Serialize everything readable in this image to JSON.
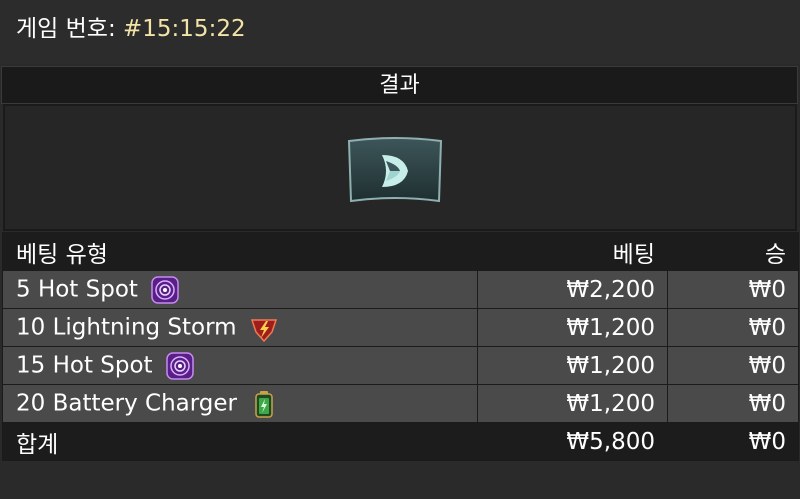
{
  "header": {
    "game_label": "게임 번호:",
    "game_number": "#15:15:22"
  },
  "result": {
    "title": "결과",
    "icon": "leaf-symbol-icon"
  },
  "table": {
    "columns": [
      "베팅 유형",
      "베팅",
      "승"
    ],
    "rows": [
      {
        "type": "5 Hot Spot",
        "icon": "hot-spot-icon",
        "bet": "₩2,200",
        "win": "₩0"
      },
      {
        "type": "10 Lightning Storm",
        "icon": "lightning-storm-icon",
        "bet": "₩1,200",
        "win": "₩0"
      },
      {
        "type": "15 Hot Spot",
        "icon": "hot-spot-icon",
        "bet": "₩1,200",
        "win": "₩0"
      },
      {
        "type": "20 Battery Charger",
        "icon": "battery-charger-icon",
        "bet": "₩1,200",
        "win": "₩0"
      }
    ],
    "total": {
      "label": "합계",
      "bet": "₩5,800",
      "win": "₩0"
    }
  },
  "colors": {
    "background": "#2a2a2a",
    "row_background": "#4a4a4a",
    "header_background": "#1c1c1c",
    "game_number": "#f3e3a6",
    "hot_spot": "#8e3ad6",
    "lightning": "#d8402a",
    "battery": "#3fa64a"
  }
}
